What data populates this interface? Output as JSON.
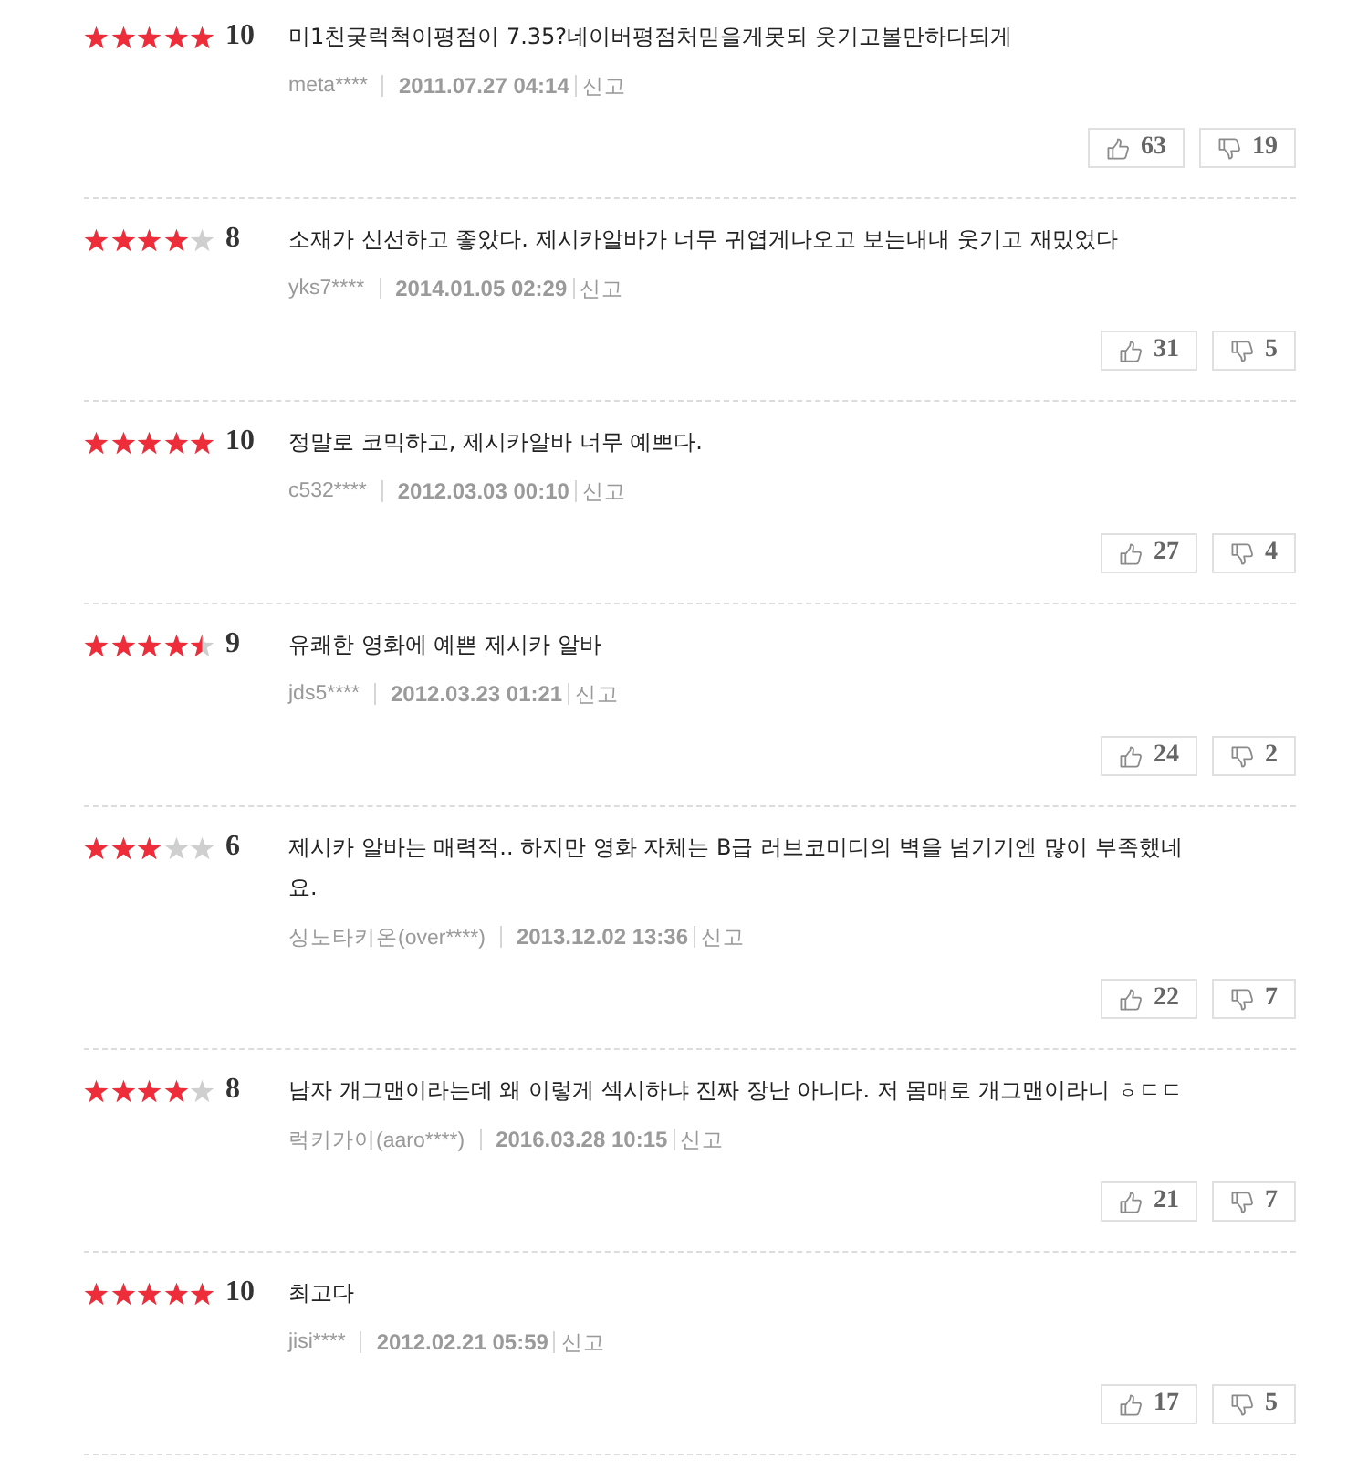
{
  "reviews": [
    {
      "stars": 5,
      "score": "10",
      "text": "미1친궂럭척이평점이 7.35?네이버평점처믿을게못되 웃기고볼만하다되게",
      "user": "meta****",
      "date": "2011.07.27 04:14",
      "report": "신고",
      "likes": "63",
      "dislikes": "19"
    },
    {
      "stars": 4,
      "score": "8",
      "text": "소재가 신선하고 좋았다. 제시카알바가 너무 귀엽게나오고 보는내내 웃기고 재밌었다",
      "user": "yks7****",
      "date": "2014.01.05 02:29",
      "report": "신고",
      "likes": "31",
      "dislikes": "5"
    },
    {
      "stars": 5,
      "score": "10",
      "text": "정말로 코믹하고, 제시카알바 너무 예쁘다.",
      "user": "c532****",
      "date": "2012.03.03 00:10",
      "report": "신고",
      "likes": "27",
      "dislikes": "4"
    },
    {
      "stars": 4.5,
      "score": "9",
      "text": "유쾌한 영화에 예쁜 제시카 알바",
      "user": "jds5****",
      "date": "2012.03.23 01:21",
      "report": "신고",
      "likes": "24",
      "dislikes": "2"
    },
    {
      "stars": 3,
      "score": "6",
      "text": "제시카 알바는 매력적.. 하지만 영화 자체는 B급 러브코미디의 벽을 넘기기엔 많이 부족했네요.",
      "user": "싱노타키온(over****)",
      "date": "2013.12.02 13:36",
      "report": "신고",
      "likes": "22",
      "dislikes": "7"
    },
    {
      "stars": 4,
      "score": "8",
      "text": "남자 개그맨이라는데 왜 이렇게 섹시하냐 진짜 장난 아니다. 저 몸매로 개그맨이라니 ㅎㄷㄷ",
      "user": "럭키가이(aaro****)",
      "date": "2016.03.28 10:15",
      "report": "신고",
      "likes": "21",
      "dislikes": "7"
    },
    {
      "stars": 5,
      "score": "10",
      "text": "최고다",
      "user": "jisi****",
      "date": "2012.02.21 05:59",
      "report": "신고",
      "likes": "17",
      "dislikes": "5"
    }
  ]
}
